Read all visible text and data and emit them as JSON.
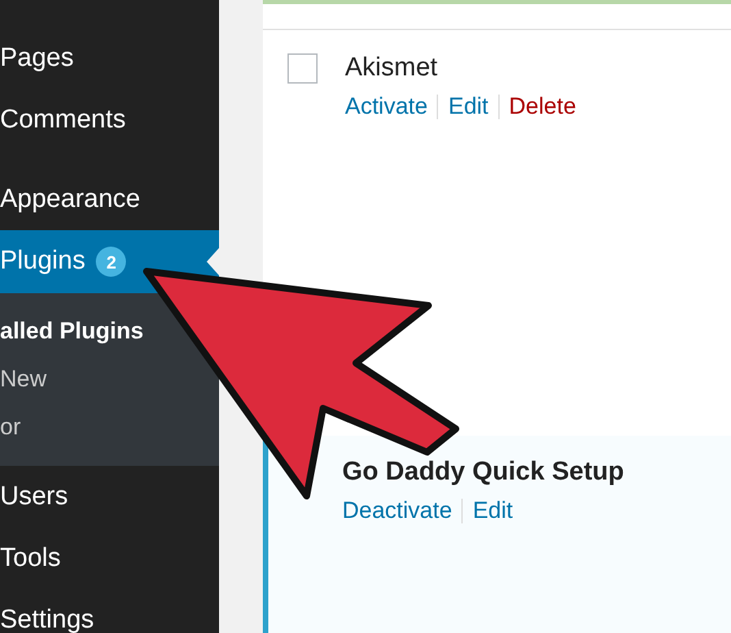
{
  "sidebar": {
    "items": [
      {
        "label": "Pages",
        "selected": false
      },
      {
        "label": "Comments",
        "selected": false
      },
      {
        "label": "Appearance",
        "selected": false
      },
      {
        "label": "Plugins",
        "selected": true,
        "badge": "2",
        "children": [
          {
            "label": "alled Plugins",
            "selected": true
          },
          {
            "label": "New",
            "selected": false
          },
          {
            "label": "or",
            "selected": false
          }
        ]
      },
      {
        "label": "Users",
        "selected": false
      },
      {
        "label": "Tools",
        "selected": false
      },
      {
        "label": "Settings",
        "selected": false
      }
    ]
  },
  "plugins_table": {
    "rows": [
      {
        "name": "Akismet",
        "active": false,
        "checked": false,
        "actions": [
          {
            "label": "Activate",
            "kind": "link"
          },
          {
            "label": "Edit",
            "kind": "link"
          },
          {
            "label": "Delete",
            "kind": "delete"
          }
        ]
      },
      {
        "name": "Go Daddy Quick Setup",
        "active": true,
        "actions": [
          {
            "label": "Deactivate",
            "kind": "link"
          },
          {
            "label": "Edit",
            "kind": "link"
          }
        ]
      }
    ]
  }
}
